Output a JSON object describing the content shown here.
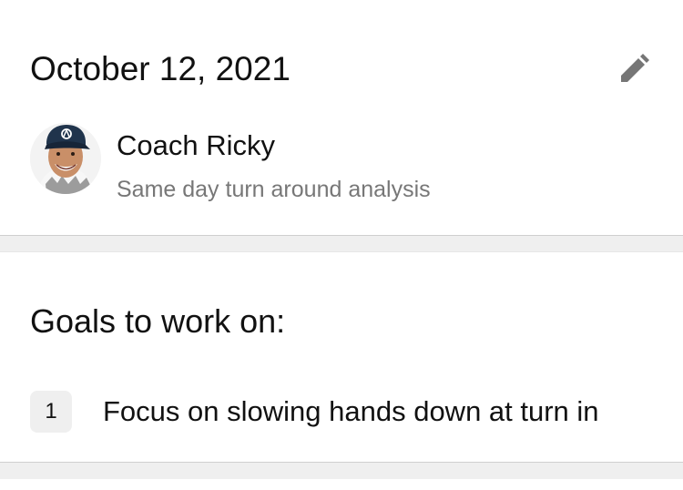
{
  "session": {
    "date": "October 12, 2021"
  },
  "edit": {
    "icon": "pencil-icon",
    "color": "#767676"
  },
  "coach": {
    "name": "Coach Ricky",
    "subtitle": "Same day turn around analysis",
    "avatar_icon": "coach-avatar"
  },
  "goals": {
    "title": "Goals to work on:",
    "items": [
      {
        "number": "1",
        "text": "Focus on slowing hands down at turn in"
      }
    ]
  }
}
